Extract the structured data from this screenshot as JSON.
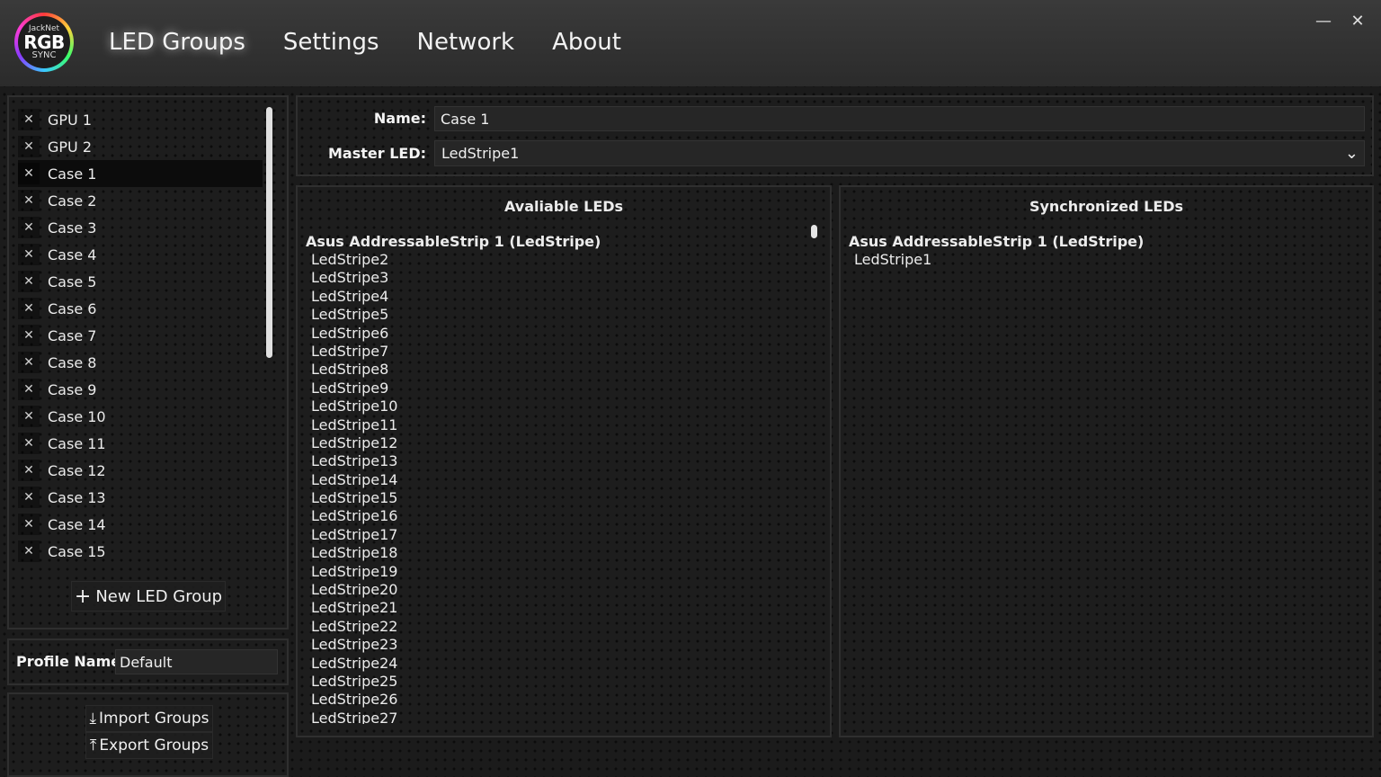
{
  "app": {
    "logo": {
      "line1": "JackNet",
      "line2": "RGB",
      "line3": "SYNC"
    },
    "window_controls": {
      "minimize": "—",
      "close": "✕"
    }
  },
  "nav": {
    "items": [
      {
        "label": "LED Groups",
        "active": true
      },
      {
        "label": "Settings"
      },
      {
        "label": "Network"
      },
      {
        "label": "About"
      }
    ]
  },
  "groups": {
    "items": [
      {
        "label": "GPU 1"
      },
      {
        "label": "GPU 2"
      },
      {
        "label": "Case 1",
        "selected": true
      },
      {
        "label": "Case 2"
      },
      {
        "label": "Case 3"
      },
      {
        "label": "Case 4"
      },
      {
        "label": "Case 5"
      },
      {
        "label": "Case 6"
      },
      {
        "label": "Case 7"
      },
      {
        "label": "Case 8"
      },
      {
        "label": "Case 9"
      },
      {
        "label": "Case 10"
      },
      {
        "label": "Case 11"
      },
      {
        "label": "Case 12"
      },
      {
        "label": "Case 13"
      },
      {
        "label": "Case 14"
      },
      {
        "label": "Case 15"
      }
    ],
    "remove_icon": "✕",
    "new_button": {
      "icon": "+",
      "label": "New LED Group"
    }
  },
  "profile": {
    "label": "Profile Name:",
    "value": "Default"
  },
  "import_export": {
    "import": {
      "icon": "⤓",
      "label": "Import Groups"
    },
    "export": {
      "icon": "⤒",
      "label": "Export Groups"
    }
  },
  "editor": {
    "name_label": "Name:",
    "name_value": "Case 1",
    "master_label": "Master LED:",
    "master_value": "LedStripe1",
    "dropdown_icon": "⌄"
  },
  "available": {
    "title": "Avaliable LEDs",
    "group_title": "Asus AddressableStrip 1 (LedStripe)",
    "items": [
      "LedStripe2",
      "LedStripe3",
      "LedStripe4",
      "LedStripe5",
      "LedStripe6",
      "LedStripe7",
      "LedStripe8",
      "LedStripe9",
      "LedStripe10",
      "LedStripe11",
      "LedStripe12",
      "LedStripe13",
      "LedStripe14",
      "LedStripe15",
      "LedStripe16",
      "LedStripe17",
      "LedStripe18",
      "LedStripe19",
      "LedStripe20",
      "LedStripe21",
      "LedStripe22",
      "LedStripe23",
      "LedStripe24",
      "LedStripe25",
      "LedStripe26",
      "LedStripe27"
    ]
  },
  "synchronized": {
    "title": "Synchronized LEDs",
    "group_title": "Asus AddressableStrip 1 (LedStripe)",
    "items": [
      "LedStripe1"
    ]
  }
}
